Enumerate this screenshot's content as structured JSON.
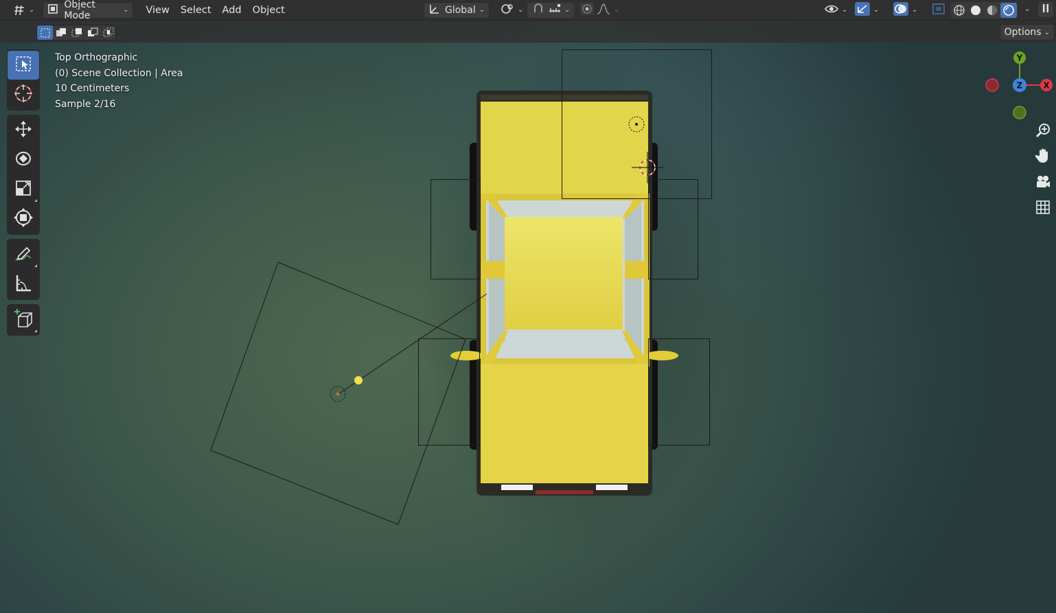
{
  "header": {
    "mode": {
      "label": "Object Mode"
    },
    "menus": [
      {
        "label": "View"
      },
      {
        "label": "Select"
      },
      {
        "label": "Add"
      },
      {
        "label": "Object"
      }
    ],
    "transform_orientation": {
      "label": "Global"
    },
    "icons": [
      "editor-type-icon",
      "object-mode-icon",
      "orientation-icon",
      "pivot-icon",
      "snap-icon",
      "snap-target-icon",
      "proportional-edit-icon",
      "falloff-icon",
      "visibility-icon",
      "gizmo-icon",
      "overlay-icon",
      "xray-icon",
      "wireframe-shading-icon",
      "solid-shading-icon",
      "material-shading-icon",
      "rendered-shading-icon"
    ]
  },
  "tool_settings": {
    "options_label": "Options"
  },
  "overlay": {
    "view_name": "Top Orthographic",
    "collection": "(0) Scene Collection | Area",
    "grid_scale": "10 Centimeters",
    "render_sample": "Sample 2/16"
  },
  "gizmo": {
    "x_label": "X",
    "y_label": "Y",
    "z_label": "Z",
    "x_color": "#e03a45",
    "y_color": "#6ea420",
    "z_color": "#3c86e0"
  },
  "toolbar": {
    "tools": [
      "select-box-icon",
      "cursor-icon",
      "move-icon",
      "rotate-icon",
      "scale-icon",
      "transform-icon",
      "annotate-icon",
      "measure-icon",
      "add-cube-icon"
    ],
    "active": "select-box-icon"
  },
  "navigation": [
    "zoom-icon",
    "pan-hand-icon",
    "camera-view-icon",
    "ortho-grid-icon"
  ],
  "colors": {
    "active_blue": "#4772b3",
    "header_bg": "#303030",
    "car_yellow": "#e4d54a"
  }
}
